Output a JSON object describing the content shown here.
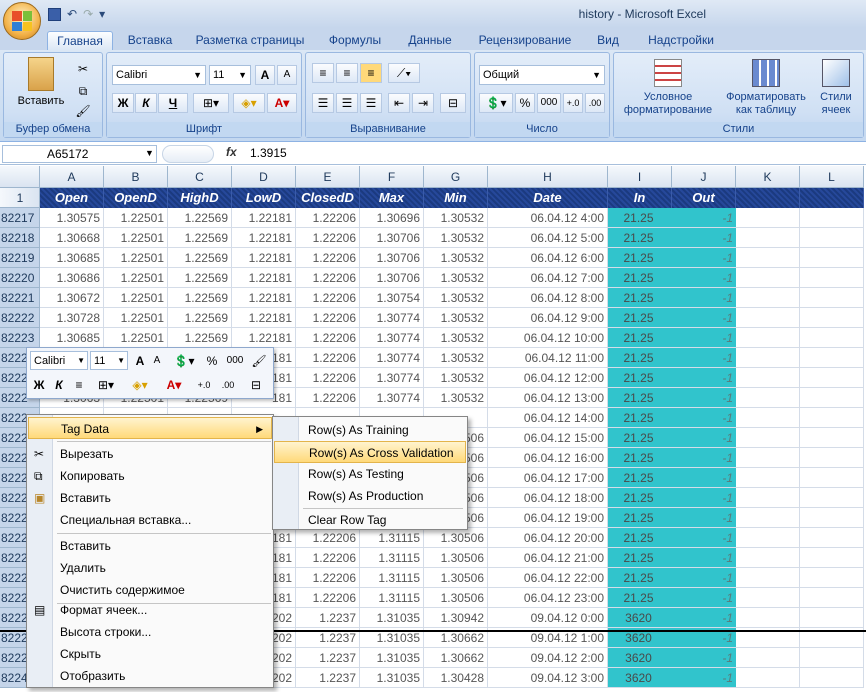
{
  "window": {
    "title": "history - Microsoft Excel"
  },
  "tabs": [
    "Главная",
    "Вставка",
    "Разметка страницы",
    "Формулы",
    "Данные",
    "Рецензирование",
    "Вид",
    "Надстройки"
  ],
  "ribbon": {
    "clipboard": {
      "label": "Буфер обмена",
      "paste": "Вставить"
    },
    "font": {
      "label": "Шрифт",
      "name": "Calibri",
      "size": "11",
      "bold": "Ж",
      "italic": "К",
      "underline": "Ч",
      "grow": "A",
      "shrink": "A"
    },
    "alignment": {
      "label": "Выравнивание"
    },
    "number": {
      "label": "Число",
      "format": "Общий",
      "percent": "%",
      "thousands": "000"
    },
    "styles": {
      "label": "Стили",
      "conditional": "Условное форматирование",
      "as_table": "Форматировать как таблицу",
      "cell_styles": "Стили ячеек"
    }
  },
  "formula_bar": {
    "name_box": "A65172",
    "fx": "fx",
    "value": "1.3915"
  },
  "columns": [
    "A",
    "B",
    "C",
    "D",
    "E",
    "F",
    "G",
    "H",
    "I",
    "J",
    "K",
    "L"
  ],
  "header_row": {
    "num": "1",
    "cells": [
      "Open",
      "OpenD",
      "HighD",
      "LowD",
      "ClosedD",
      "Max",
      "Min",
      "Date",
      "In",
      "Out"
    ]
  },
  "rows": [
    {
      "num": "82217",
      "cells": [
        "1.30575",
        "1.22501",
        "1.22569",
        "1.22181",
        "1.22206",
        "1.30696",
        "1.30532",
        "06.04.12 4:00",
        "21.25",
        "-1"
      ]
    },
    {
      "num": "82218",
      "cells": [
        "1.30668",
        "1.22501",
        "1.22569",
        "1.22181",
        "1.22206",
        "1.30706",
        "1.30532",
        "06.04.12 5:00",
        "21.25",
        "-1"
      ]
    },
    {
      "num": "82219",
      "cells": [
        "1.30685",
        "1.22501",
        "1.22569",
        "1.22181",
        "1.22206",
        "1.30706",
        "1.30532",
        "06.04.12 6:00",
        "21.25",
        "-1"
      ]
    },
    {
      "num": "82220",
      "cells": [
        "1.30686",
        "1.22501",
        "1.22569",
        "1.22181",
        "1.22206",
        "1.30706",
        "1.30532",
        "06.04.12 7:00",
        "21.25",
        "-1"
      ]
    },
    {
      "num": "82221",
      "cells": [
        "1.30672",
        "1.22501",
        "1.22569",
        "1.22181",
        "1.22206",
        "1.30754",
        "1.30532",
        "06.04.12 8:00",
        "21.25",
        "-1"
      ]
    },
    {
      "num": "82222",
      "cells": [
        "1.30728",
        "1.22501",
        "1.22569",
        "1.22181",
        "1.22206",
        "1.30774",
        "1.30532",
        "06.04.12 9:00",
        "21.25",
        "-1"
      ]
    },
    {
      "num": "82223",
      "cells": [
        "1.30685",
        "1.22501",
        "1.22569",
        "1.22181",
        "1.22206",
        "1.30774",
        "1.30532",
        "06.04.12 10:00",
        "21.25",
        "-1"
      ]
    },
    {
      "num": "8222",
      "cells": [
        "",
        "",
        "",
        "181",
        "1.22206",
        "1.30774",
        "1.30532",
        "06.04.12 11:00",
        "21.25",
        "-1"
      ]
    },
    {
      "num": "8222",
      "cells": [
        "",
        "",
        "",
        "181",
        "1.22206",
        "1.30774",
        "1.30532",
        "06.04.12 12:00",
        "21.25",
        "-1"
      ]
    },
    {
      "num": "8222",
      "cells": [
        "1.3063",
        "1.22501",
        "1.22569",
        "181",
        "1.22206",
        "1.30774",
        "1.30532",
        "06.04.12 13:00",
        "21.25",
        "-1"
      ]
    },
    {
      "num": "8222",
      "cells": [
        "",
        "",
        "",
        "",
        "",
        "",
        "",
        "06.04.12 14:00",
        "21.25",
        "-1"
      ]
    },
    {
      "num": "8222",
      "cells": [
        "",
        "",
        "",
        "",
        "",
        "",
        "506",
        "06.04.12 15:00",
        "21.25",
        "-1"
      ]
    },
    {
      "num": "8222",
      "cells": [
        "",
        "",
        "",
        "",
        "",
        "",
        "506",
        "06.04.12 16:00",
        "21.25",
        "-1"
      ]
    },
    {
      "num": "8222",
      "cells": [
        "",
        "",
        "",
        "",
        "",
        "",
        "506",
        "06.04.12 17:00",
        "21.25",
        "-1"
      ]
    },
    {
      "num": "8222",
      "cells": [
        "",
        "",
        "",
        "",
        "",
        "",
        "506",
        "06.04.12 18:00",
        "21.25",
        "-1"
      ]
    },
    {
      "num": "8222",
      "cells": [
        "",
        "",
        "",
        "",
        "",
        "",
        "506",
        "06.04.12 19:00",
        "21.25",
        "-1"
      ]
    },
    {
      "num": "8222",
      "cells": [
        "",
        "",
        "",
        "181",
        "1.22206",
        "1.31115",
        "1.30506",
        "06.04.12 20:00",
        "21.25",
        "-1"
      ]
    },
    {
      "num": "8222",
      "cells": [
        "",
        "",
        "",
        "181",
        "1.22206",
        "1.31115",
        "1.30506",
        "06.04.12 21:00",
        "21.25",
        "-1"
      ]
    },
    {
      "num": "8222",
      "cells": [
        "",
        "",
        "",
        "181",
        "1.22206",
        "1.31115",
        "1.30506",
        "06.04.12 22:00",
        "21.25",
        "-1"
      ]
    },
    {
      "num": "8222",
      "cells": [
        "",
        "",
        "",
        "181",
        "1.22206",
        "1.31115",
        "1.30506",
        "06.04.12 23:00",
        "21.25",
        "-1"
      ]
    },
    {
      "num": "8222",
      "cells": [
        "",
        "",
        "",
        "202",
        "1.2237",
        "1.31035",
        "1.30942",
        "09.04.12 0:00",
        "3620",
        "-1"
      ]
    },
    {
      "num": "8222",
      "cells": [
        "",
        "",
        "",
        "202",
        "1.2237",
        "1.31035",
        "1.30662",
        "09.04.12 1:00",
        "3620",
        "-1"
      ]
    },
    {
      "num": "8222",
      "cells": [
        "",
        "",
        "",
        "202",
        "1.2237",
        "1.31035",
        "1.30662",
        "09.04.12 2:00",
        "3620",
        "-1"
      ]
    },
    {
      "num": "8224",
      "cells": [
        "",
        "",
        "",
        "202",
        "1.2237",
        "1.31035",
        "1.30428",
        "09.04.12 3:00",
        "3620",
        "-1"
      ]
    }
  ],
  "mini_toolbar": {
    "font": "Calibri",
    "size": "11",
    "bold": "Ж",
    "italic": "К",
    "percent": "%",
    "thousands": "000"
  },
  "context_menu": [
    {
      "label": "Tag Data",
      "submenu": true
    },
    {
      "label": "Вырезать"
    },
    {
      "label": "Копировать"
    },
    {
      "label": "Вставить"
    },
    {
      "label": "Специальная вставка..."
    },
    {
      "label": "Вставить"
    },
    {
      "label": "Удалить"
    },
    {
      "label": "Очистить содержимое"
    },
    {
      "label": "Формат ячеек..."
    },
    {
      "label": "Высота строки..."
    },
    {
      "label": "Скрыть"
    },
    {
      "label": "Отобразить"
    }
  ],
  "submenu": [
    {
      "label": "Row(s) As Training"
    },
    {
      "label": "Row(s) As Cross Validation"
    },
    {
      "label": "Row(s) As Testing"
    },
    {
      "label": "Row(s) As Production"
    },
    {
      "label": "Clear Row Tag"
    }
  ],
  "colors": {
    "header_bg": "#1b3a80",
    "teal": "#31c4cc",
    "accent": "#15428b"
  }
}
